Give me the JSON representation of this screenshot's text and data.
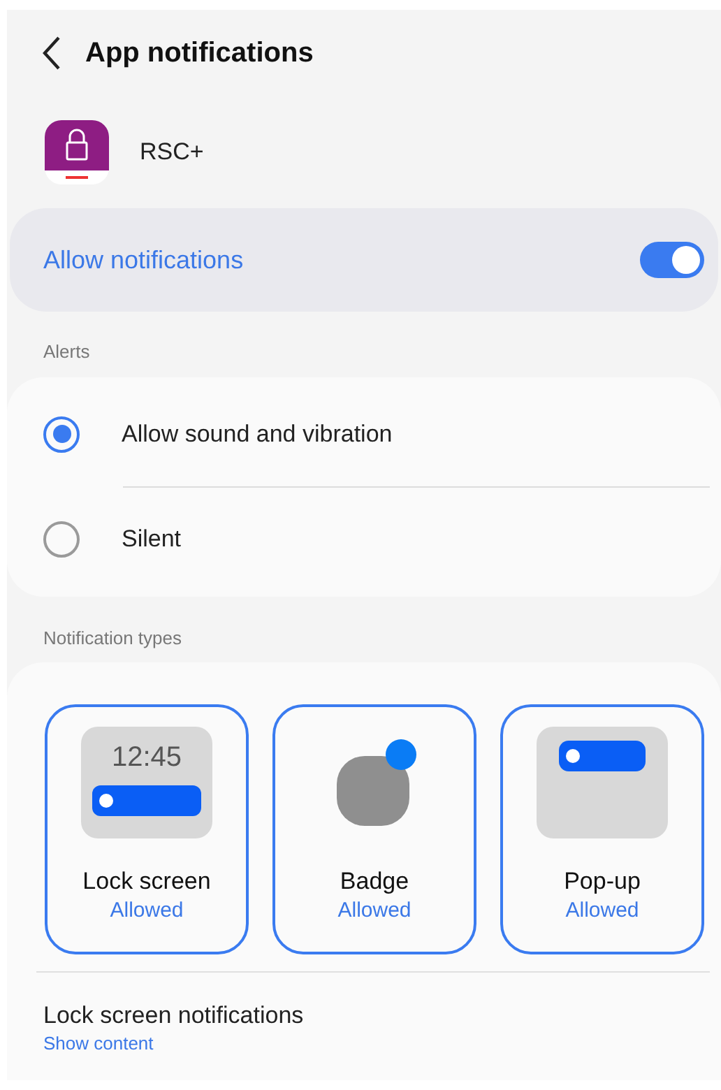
{
  "header": {
    "title": "App notifications"
  },
  "app": {
    "name": "RSC+"
  },
  "allow_notifications": {
    "label": "Allow notifications",
    "on": true
  },
  "alerts": {
    "heading": "Alerts",
    "options": [
      {
        "label": "Allow sound and vibration",
        "selected": true
      },
      {
        "label": "Silent",
        "selected": false
      }
    ]
  },
  "notification_types": {
    "heading": "Notification types",
    "types": [
      {
        "kind": "lock_screen",
        "preview_time": "12:45",
        "label": "Lock screen",
        "status": "Allowed",
        "selected": true
      },
      {
        "kind": "badge",
        "label": "Badge",
        "status": "Allowed",
        "selected": true
      },
      {
        "kind": "popup",
        "label": "Pop-up",
        "status": "Allowed",
        "selected": true
      }
    ]
  },
  "lock_screen_notifications": {
    "label": "Lock screen notifications",
    "value": "Show content"
  }
}
